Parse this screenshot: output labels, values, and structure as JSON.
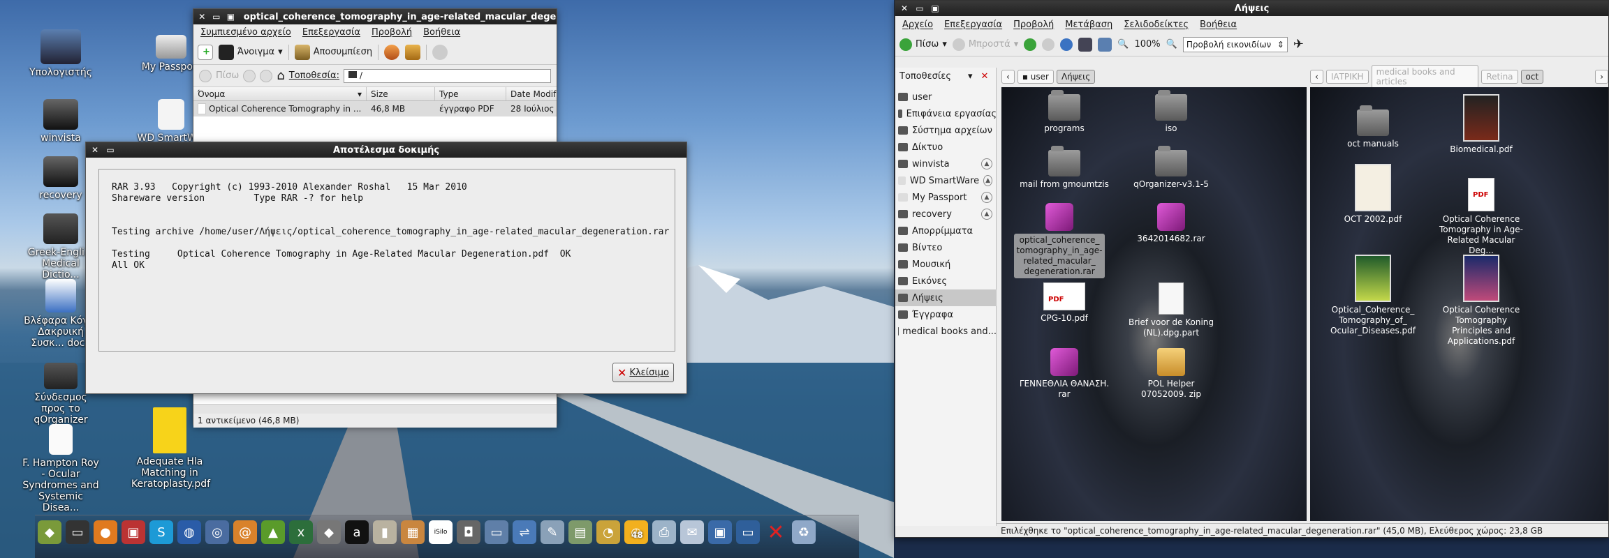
{
  "desktop": {
    "icons": [
      {
        "label": "Υπολογιστής",
        "name": "desktop-computer-icon"
      },
      {
        "label": "My Passport",
        "name": "desktop-mypassport-icon"
      },
      {
        "label": "winvista",
        "name": "desktop-winvista-icon"
      },
      {
        "label": "WD SmartW...",
        "name": "desktop-wdsmartware-icon"
      },
      {
        "label": "recovery",
        "name": "desktop-recovery-icon"
      },
      {
        "label": "Greek-Engli... Medical Dictio...",
        "name": "desktop-greek-dictionary-icon"
      },
      {
        "label": "Βλέφαρα Κόγ... Δακρυική Συσκ... docx",
        "name": "desktop-docx-icon"
      },
      {
        "label": "Σύνδεσμος προς το qOrganizer",
        "name": "desktop-qorganizer-link-icon"
      },
      {
        "label": "F. Hampton Roy - Ocular Syndromes and Systemic Disea...",
        "name": "desktop-hampton-roy-icon"
      },
      {
        "label": "Adequate Hla Matching in Keratoplasty.pdf",
        "name": "desktop-adequate-hla-icon"
      }
    ],
    "dock_badge": "48"
  },
  "archive": {
    "title": "optical_coherence_tomography_in_age-related_macular_degenerat",
    "menu": [
      "Συμπιεσμένο αρχείο",
      "Επεξεργασία",
      "Προβολή",
      "Βοήθεια"
    ],
    "toolbar": {
      "open": "Άνοιγμα",
      "extract": "Αποσυμπίεση"
    },
    "back": "Πίσω",
    "location_label": "Τοποθεσία:",
    "location_value": "/",
    "columns": [
      "Όνομα",
      "Size",
      "Type",
      "Date Modif"
    ],
    "rows": [
      {
        "name": "Optical Coherence Tomography in ...",
        "size": "46,8 MB",
        "type": "έγγραφο PDF",
        "date": "28 Ιούλιος"
      }
    ],
    "status": "1 αντικείμενο (46,8 MB)"
  },
  "dialog": {
    "title": "Αποτέλεσμα δοκιμής",
    "console": "RAR 3.93   Copyright (c) 1993-2010 Alexander Roshal   15 Mar 2010\nShareware version         Type RAR -? for help\n\n\nTesting archive /home/user/Λήψεις/optical_coherence_tomography_in_age-related_macular_degeneration.rar\n\nTesting     Optical Coherence Tomography in Age-Related Macular Degeneration.pdf  OK\nAll OK",
    "close_label": "Κλείσιμο"
  },
  "downloads": {
    "title": "Λήψεις",
    "menu": [
      "Αρχείο",
      "Επεξεργασία",
      "Προβολή",
      "Μετάβαση",
      "Σελιδοδείκτες",
      "Βοήθεια"
    ],
    "toolbar": {
      "back": "Πίσω",
      "forward": "Μπροστά",
      "zoom": "100%",
      "view": "Προβολή εικονιδίων"
    },
    "places_label": "Τοποθεσίες",
    "places": [
      "user",
      "Επιφάνεια εργασίας",
      "Σύστημα αρχείων",
      "Δίκτυο",
      "winvista",
      "WD SmartWare",
      "My Passport",
      "recovery",
      "Απορρίμματα",
      "Βίντεο",
      "Μουσική",
      "Εικόνες",
      "Λήψεις",
      "Έγγραφα",
      "medical books and..."
    ],
    "left_crumbs": [
      "user",
      "Λήψεις"
    ],
    "right_crumbs": [
      "ΙΑΤΡΙΚΗ",
      "medical books and articles",
      "Retina",
      "oct"
    ],
    "left_files": [
      "programs",
      "iso",
      "mail from gmoumtzis",
      "qOrganizer-v3.1-5",
      "optical_coherence_ tomography_in_age- related_macular_ degeneration.rar",
      "3642014682.rar",
      "CPG-10.pdf",
      "Brief voor de Koning (NL).dpg.part",
      "ΓΕΝΝΕΘΛΙΑ ΘΑΝΑΣΗ. rar",
      "POL Helper 07052009. zip"
    ],
    "right_files": [
      "oct manuals",
      "Biomedical.pdf",
      "OCT 2002.pdf",
      "Optical Coherence Tomography in Age- Related Macular Deg...",
      "Optical_Coherence_ Tomography_of_ Ocular_Diseases.pdf",
      "Optical Coherence Tomography Principles and Applications.pdf"
    ],
    "status": "Επιλέχθηκε το \"optical_coherence_tomography_in_age-related_macular_degeneration.rar\" (45,0 MB), Ελεύθερος χώρος: 23,8 GB"
  }
}
